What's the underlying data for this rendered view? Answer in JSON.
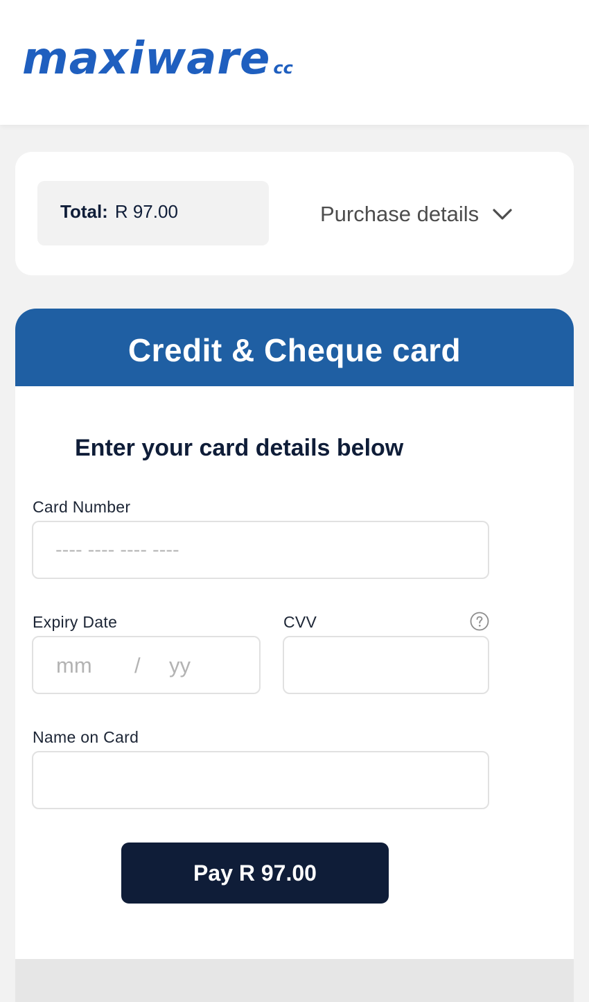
{
  "header": {
    "logo_text": "maxiware",
    "logo_suffix": "cc"
  },
  "summary": {
    "total_label": "Total:",
    "total_amount": "R 97.00",
    "purchase_details_label": "Purchase details",
    "purchase_details_icon": "chevron-down-icon"
  },
  "payment": {
    "header_title": "Credit & Cheque card",
    "instruction": "Enter your card details below",
    "card_number": {
      "label": "Card Number",
      "placeholder": "---- ---- ---- ----",
      "value": ""
    },
    "expiry": {
      "label": "Expiry Date",
      "month_placeholder": "mm",
      "separator": "/",
      "year_placeholder": "yy"
    },
    "cvv": {
      "label": "CVV",
      "placeholder": "",
      "value": "",
      "help_icon": "question-circle-icon"
    },
    "name_on_card": {
      "label": "Name on Card",
      "placeholder": "",
      "value": ""
    },
    "pay_button_label": "Pay R 97.00"
  },
  "colors": {
    "brand_blue": "#1f5fbf",
    "header_blue": "#1f5fa3",
    "navy": "#0f1d38",
    "page_background": "#f2f2f2"
  }
}
